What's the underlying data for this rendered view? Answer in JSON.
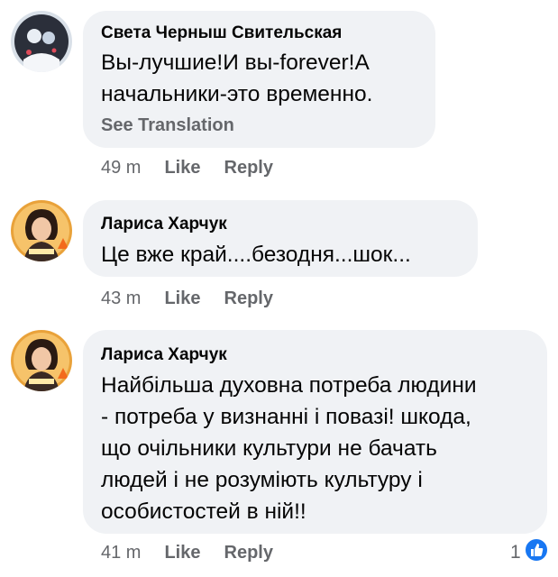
{
  "comments": [
    {
      "author": "Света Черныш Свительская",
      "text": "Вы-лучшие!И вы-forever!А\nначальники-это временно.",
      "see_translation": "See Translation",
      "time": "49 m",
      "like_label": "Like",
      "reply_label": "Reply"
    },
    {
      "author": "Лариса Харчук",
      "text": "Це вже край....безодня...шок...",
      "time": "43 m",
      "like_label": "Like",
      "reply_label": "Reply"
    },
    {
      "author": "Лариса Харчук",
      "text": "Найбільша духовна потреба людини\n- потреба у визнанні і повазі! шкода,\nщо очільники культури не бачать\nлюдей і не розуміють культуру і\nособистостей в ній!!",
      "time": "41 m",
      "like_label": "Like",
      "reply_label": "Reply",
      "reaction_count": "1",
      "reaction_icon": "thumbs-up-icon"
    }
  ],
  "colors": {
    "bubble": "#f0f2f5",
    "meta": "#65676b",
    "like_blue": "#1877f2"
  }
}
